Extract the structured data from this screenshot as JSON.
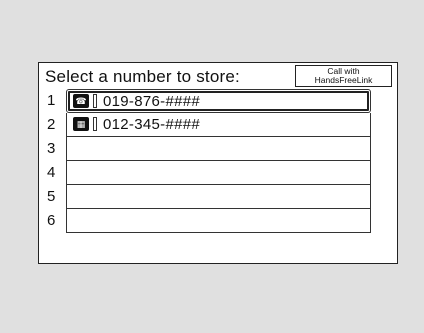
{
  "screen": {
    "title": "Select a number to store:",
    "call_button_line1": "Call with",
    "call_button_line2": "HandsFreeLink"
  },
  "rows": [
    {
      "index": "1",
      "icon": "mobile-phone-icon",
      "icon_glyph": "☎",
      "number": "019-876-####",
      "selected": true
    },
    {
      "index": "2",
      "icon": "work-phone-icon",
      "icon_glyph": "▦",
      "number": "012-345-####",
      "selected": false
    },
    {
      "index": "3",
      "number": ""
    },
    {
      "index": "4",
      "number": ""
    },
    {
      "index": "5",
      "number": ""
    },
    {
      "index": "6",
      "number": ""
    }
  ]
}
